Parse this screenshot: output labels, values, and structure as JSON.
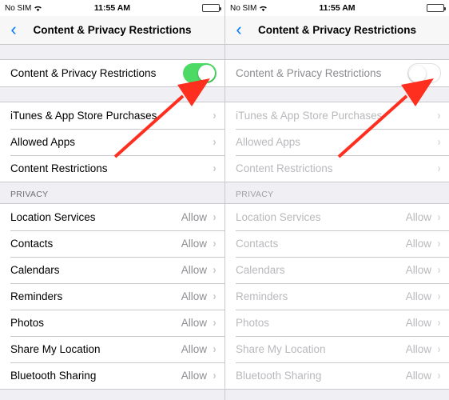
{
  "status_bar": {
    "carrier": "No SIM",
    "time": "11:55 AM",
    "wifi_icon": "wifi-icon",
    "battery_icon": "battery-icon"
  },
  "nav": {
    "back_icon": "chevron-left-icon",
    "title": "Content & Privacy Restrictions"
  },
  "left_screen": {
    "master_toggle": {
      "label": "Content & Privacy Restrictions",
      "state": "on",
      "on_color": "#4cd964"
    },
    "restriction_rows": [
      {
        "label": "iTunes & App Store Purchases",
        "value": "",
        "chevron": "chevron-right-icon"
      },
      {
        "label": "Allowed Apps",
        "value": "",
        "chevron": "chevron-right-icon"
      },
      {
        "label": "Content Restrictions",
        "value": "",
        "chevron": "chevron-right-icon"
      }
    ],
    "privacy_header": "PRIVACY",
    "privacy_rows": [
      {
        "label": "Location Services",
        "value": "Allow",
        "chevron": "chevron-right-icon"
      },
      {
        "label": "Contacts",
        "value": "Allow",
        "chevron": "chevron-right-icon"
      },
      {
        "label": "Calendars",
        "value": "Allow",
        "chevron": "chevron-right-icon"
      },
      {
        "label": "Reminders",
        "value": "Allow",
        "chevron": "chevron-right-icon"
      },
      {
        "label": "Photos",
        "value": "Allow",
        "chevron": "chevron-right-icon"
      },
      {
        "label": "Share My Location",
        "value": "Allow",
        "chevron": "chevron-right-icon"
      },
      {
        "label": "Bluetooth Sharing",
        "value": "Allow",
        "chevron": "chevron-right-icon"
      }
    ]
  },
  "right_screen": {
    "master_toggle": {
      "label": "Content & Privacy Restrictions",
      "state": "off",
      "off_color": "#ffffff"
    },
    "restriction_rows": [
      {
        "label": "iTunes & App Store Purchases",
        "value": "",
        "chevron": "chevron-right-icon"
      },
      {
        "label": "Allowed Apps",
        "value": "",
        "chevron": "chevron-right-icon"
      },
      {
        "label": "Content Restrictions",
        "value": "",
        "chevron": "chevron-right-icon"
      }
    ],
    "privacy_header": "PRIVACY",
    "privacy_rows": [
      {
        "label": "Location Services",
        "value": "Allow",
        "chevron": "chevron-right-icon"
      },
      {
        "label": "Contacts",
        "value": "Allow",
        "chevron": "chevron-right-icon"
      },
      {
        "label": "Calendars",
        "value": "Allow",
        "chevron": "chevron-right-icon"
      },
      {
        "label": "Reminders",
        "value": "Allow",
        "chevron": "chevron-right-icon"
      },
      {
        "label": "Photos",
        "value": "Allow",
        "chevron": "chevron-right-icon"
      },
      {
        "label": "Share My Location",
        "value": "Allow",
        "chevron": "chevron-right-icon"
      },
      {
        "label": "Bluetooth Sharing",
        "value": "Allow",
        "chevron": "chevron-right-icon"
      }
    ]
  },
  "annotations": {
    "arrow_color": "#ff2f20",
    "arrows": [
      {
        "name": "arrow-pointing-to-left-toggle",
        "target": "left master toggle"
      },
      {
        "name": "arrow-pointing-to-right-toggle",
        "target": "right master toggle"
      }
    ]
  }
}
